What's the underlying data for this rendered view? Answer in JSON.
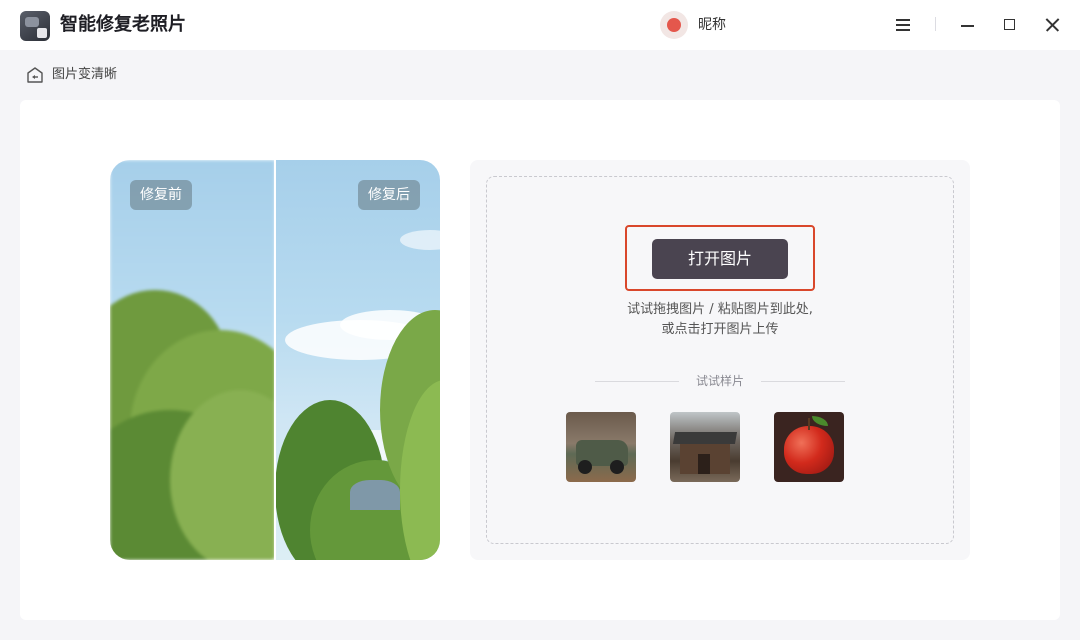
{
  "app": {
    "title": "智能修复老照片",
    "user_nickname": "昵称"
  },
  "window_controls": [
    "menu",
    "minimize",
    "maximize",
    "close"
  ],
  "breadcrumb": {
    "label": "图片变清晰",
    "icon": "home-icon"
  },
  "compare": {
    "before_label": "修复前",
    "after_label": "修复后"
  },
  "upload": {
    "open_button_label": "打开图片",
    "hint_line1": "试试拖拽图片 / 粘贴图片到此处,",
    "hint_line2": "或点击打开图片上传",
    "samples_title": "试试样片",
    "samples": [
      {
        "subject": "vintage-truck"
      },
      {
        "subject": "old-house"
      },
      {
        "subject": "red-apple"
      }
    ]
  },
  "colors": {
    "accent_button": "#4a4450",
    "highlight_border": "#d9472b",
    "background": "#f5f5f8"
  }
}
